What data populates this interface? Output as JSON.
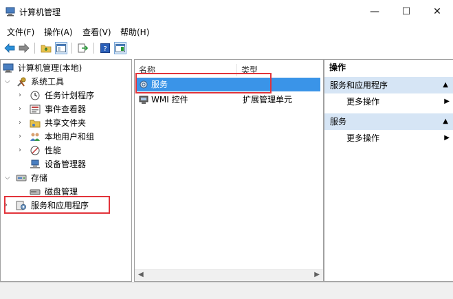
{
  "window": {
    "title": "计算机管理",
    "minimize": "—",
    "maximize": "☐",
    "close": "✕"
  },
  "menu": [
    "文件(F)",
    "操作(A)",
    "查看(V)",
    "帮助(H)"
  ],
  "tree": {
    "root": "计算机管理(本地)",
    "system_tools": "系统工具",
    "task_scheduler": "任务计划程序",
    "event_viewer": "事件查看器",
    "shared_folders": "共享文件夹",
    "local_users": "本地用户和组",
    "performance": "性能",
    "device_manager": "设备管理器",
    "storage": "存储",
    "disk_management": "磁盘管理",
    "services_apps": "服务和应用程序"
  },
  "list": {
    "col_name": "名称",
    "col_type": "类型",
    "rows": [
      {
        "name": "服务",
        "type": ""
      },
      {
        "name": "WMI 控件",
        "type": "扩展管理单元"
      }
    ]
  },
  "actions": {
    "header": "操作",
    "section1": "服务和应用程序",
    "more1": "更多操作",
    "section2": "服务",
    "more2": "更多操作"
  },
  "colors": {
    "selection": "#3a94e8",
    "highlight_box": "#e2333a",
    "action_section_bg": "#d6e5f5"
  }
}
